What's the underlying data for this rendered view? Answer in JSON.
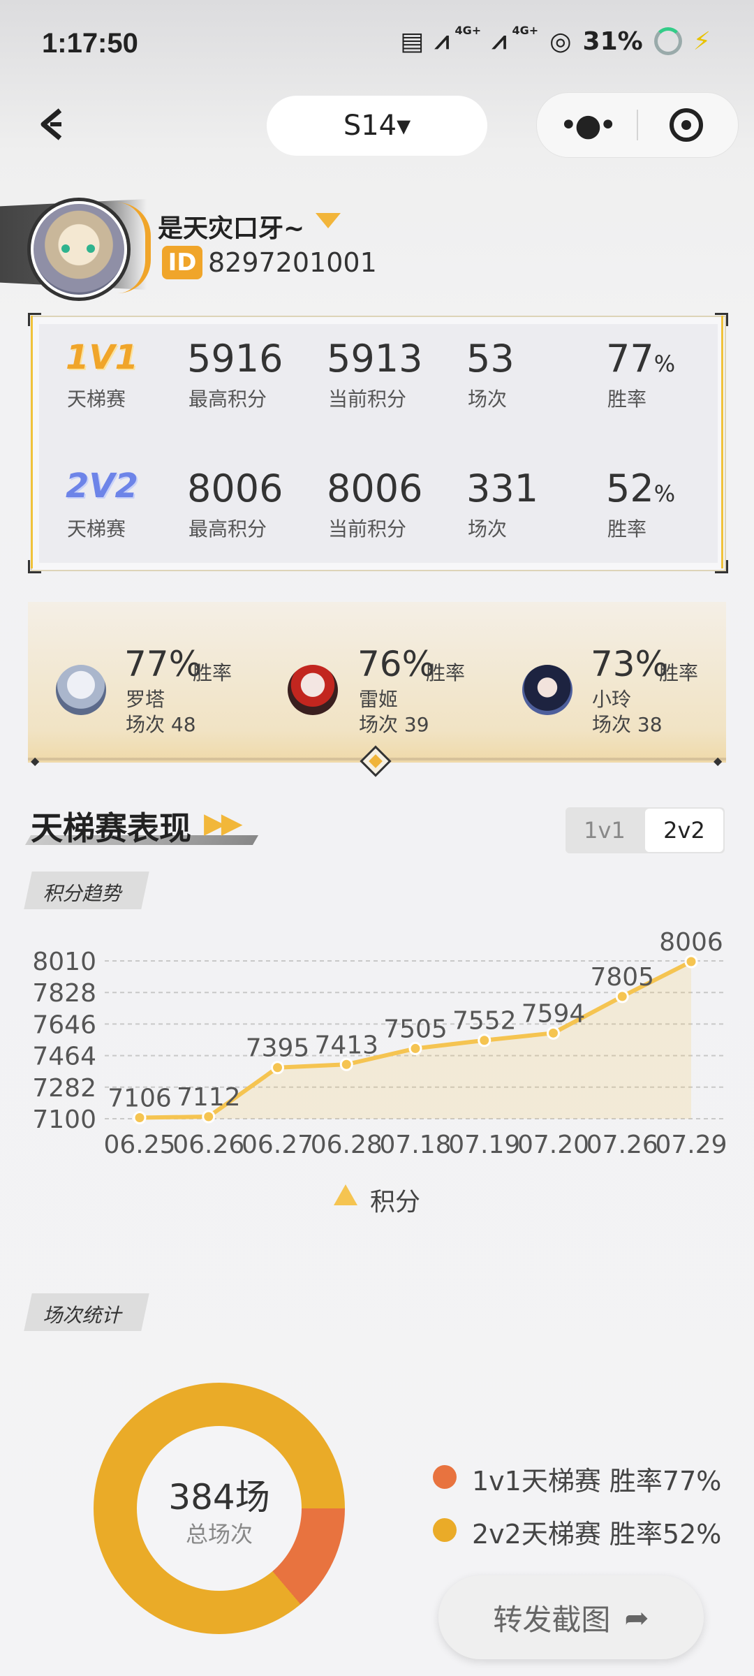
{
  "status_bar": {
    "time": "1:17:50",
    "net1": "4G+",
    "net2": "4G+",
    "battery": "31%"
  },
  "nav": {
    "season": "S14▾"
  },
  "profile": {
    "name": "是天灾口牙~",
    "id_badge": "ID",
    "id": "8297201001"
  },
  "stats": [
    {
      "mode": "1V1",
      "mode_sub": "天梯赛",
      "max": "5916",
      "max_label": "最高积分",
      "current": "5913",
      "current_label": "当前积分",
      "games": "53",
      "games_label": "场次",
      "win": "77",
      "win_unit": "%",
      "win_label": "胜率"
    },
    {
      "mode": "2V2",
      "mode_sub": "天梯赛",
      "max": "8006",
      "max_label": "最高积分",
      "current": "8006",
      "current_label": "当前积分",
      "games": "331",
      "games_label": "场次",
      "win": "52",
      "win_unit": "%",
      "win_label": "胜率"
    }
  ],
  "heroes": [
    {
      "pct": "77%",
      "win_label": "胜率",
      "name": "罗塔",
      "games": "场次 48"
    },
    {
      "pct": "76%",
      "win_label": "胜率",
      "name": "雷姬",
      "games": "场次 39"
    },
    {
      "pct": "73%",
      "win_label": "胜率",
      "name": "小玲",
      "games": "场次 38"
    }
  ],
  "section": {
    "title": "天梯赛表现",
    "tab1": "1v1",
    "tab2": "2v2",
    "trend_tag": "积分趋势",
    "count_tag": "场次统计"
  },
  "chart_data": {
    "type": "line",
    "categories": [
      "06.25",
      "06.26",
      "06.27",
      "06.28",
      "07.18",
      "07.19",
      "07.20",
      "07.26",
      "07.29"
    ],
    "series": [
      {
        "name": "积分",
        "values": [
          7106,
          7112,
          7395,
          7413,
          7505,
          7552,
          7594,
          7805,
          8006
        ]
      }
    ],
    "y_ticks": [
      "8010",
      "7828",
      "7646",
      "7464",
      "7282",
      "7100"
    ],
    "x_tick_labels": [
      "06.25",
      "06.26",
      "06.27",
      "06.28",
      "07.18",
      "07.19",
      "07.20",
      "07.26",
      "07.29"
    ],
    "ylim": [
      7100,
      8010
    ],
    "grid": true,
    "legend": "bottom",
    "color": "#f5c451"
  },
  "donut": {
    "total": "384场",
    "total_label": "总场次",
    "slices": [
      {
        "name": "1v1天梯赛 胜率77%",
        "value": 53,
        "color": "#e8733f"
      },
      {
        "name": "2v2天梯赛 胜率52%",
        "value": 331,
        "color": "#eaab28"
      }
    ]
  },
  "share_label": "转发截图"
}
